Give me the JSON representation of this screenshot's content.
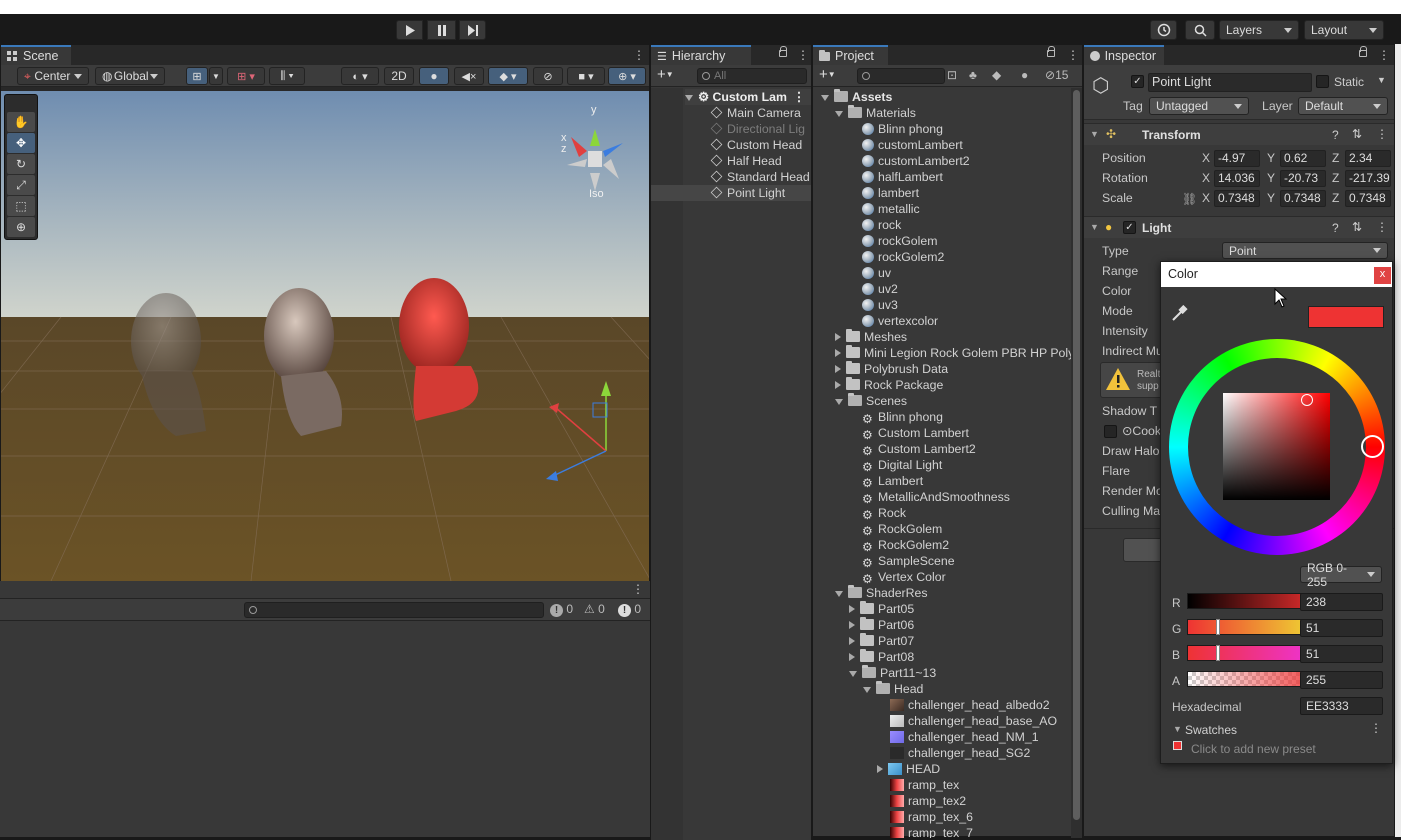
{
  "toolbar": {
    "play_icon": "play-icon",
    "pause_icon": "pause-icon",
    "step_icon": "step-icon",
    "history_icon": "history-icon",
    "search_icon": "search-icon",
    "layers": "Layers",
    "layout": "Layout"
  },
  "scene": {
    "tab": "Scene",
    "pivot": "Center",
    "space": "Global",
    "mode_2d": "2D",
    "gizmo_label": "Iso",
    "axis_y": "y",
    "axis_x": "x",
    "axis_z": "z",
    "tools": [
      "hand-tool-icon",
      "move-tool-icon",
      "rotate-tool-icon",
      "scale-tool-icon",
      "rect-tool-icon",
      "transform-tool-icon"
    ]
  },
  "console": {
    "info_count": "0",
    "warn_count": "0",
    "error_count": "0"
  },
  "hierarchy": {
    "tab": "Hierarchy",
    "search_placeholder": "All",
    "root": "Custom Lam",
    "items": [
      "Main Camera",
      "Directional Lig",
      "Custom Head",
      "Half Head",
      "Standard Head",
      "Point Light"
    ]
  },
  "project": {
    "tab": "Project",
    "hidden_count": "15",
    "rows": [
      {
        "label": "Assets",
        "indent": 0,
        "icon": "folder",
        "arrow": "down",
        "bold": true
      },
      {
        "label": "Materials",
        "indent": 1,
        "icon": "folder",
        "arrow": "down"
      },
      {
        "label": "Blinn phong",
        "indent": 2,
        "icon": "material"
      },
      {
        "label": "customLambert",
        "indent": 2,
        "icon": "material"
      },
      {
        "label": "customLambert2",
        "indent": 2,
        "icon": "material"
      },
      {
        "label": "halfLambert",
        "indent": 2,
        "icon": "material"
      },
      {
        "label": "lambert",
        "indent": 2,
        "icon": "material"
      },
      {
        "label": "metallic",
        "indent": 2,
        "icon": "material"
      },
      {
        "label": "rock",
        "indent": 2,
        "icon": "material"
      },
      {
        "label": "rockGolem",
        "indent": 2,
        "icon": "material"
      },
      {
        "label": "rockGolem2",
        "indent": 2,
        "icon": "material"
      },
      {
        "label": "uv",
        "indent": 2,
        "icon": "material"
      },
      {
        "label": "uv2",
        "indent": 2,
        "icon": "material"
      },
      {
        "label": "uv3",
        "indent": 2,
        "icon": "material"
      },
      {
        "label": "vertexcolor",
        "indent": 2,
        "icon": "material"
      },
      {
        "label": "Meshes",
        "indent": 1,
        "icon": "folder",
        "arrow": "right"
      },
      {
        "label": "Mini Legion Rock Golem PBR HP Poly",
        "indent": 1,
        "icon": "folder",
        "arrow": "right"
      },
      {
        "label": "Polybrush Data",
        "indent": 1,
        "icon": "folder",
        "arrow": "right"
      },
      {
        "label": "Rock Package",
        "indent": 1,
        "icon": "folder",
        "arrow": "right"
      },
      {
        "label": "Scenes",
        "indent": 1,
        "icon": "folder",
        "arrow": "down"
      },
      {
        "label": "Blinn phong",
        "indent": 2,
        "icon": "scene"
      },
      {
        "label": "Custom Lambert",
        "indent": 2,
        "icon": "scene"
      },
      {
        "label": "Custom Lambert2",
        "indent": 2,
        "icon": "scene"
      },
      {
        "label": "Digital Light",
        "indent": 2,
        "icon": "scene"
      },
      {
        "label": "Lambert",
        "indent": 2,
        "icon": "scene"
      },
      {
        "label": "MetallicAndSmoothness",
        "indent": 2,
        "icon": "scene"
      },
      {
        "label": "Rock",
        "indent": 2,
        "icon": "scene"
      },
      {
        "label": "RockGolem",
        "indent": 2,
        "icon": "scene"
      },
      {
        "label": "RockGolem2",
        "indent": 2,
        "icon": "scene"
      },
      {
        "label": "SampleScene",
        "indent": 2,
        "icon": "scene"
      },
      {
        "label": "Vertex Color",
        "indent": 2,
        "icon": "scene"
      },
      {
        "label": "ShaderRes",
        "indent": 1,
        "icon": "folder",
        "arrow": "down"
      },
      {
        "label": "Part05",
        "indent": 2,
        "icon": "folder",
        "arrow": "right"
      },
      {
        "label": "Part06",
        "indent": 2,
        "icon": "folder",
        "arrow": "right"
      },
      {
        "label": "Part07",
        "indent": 2,
        "icon": "folder",
        "arrow": "right"
      },
      {
        "label": "Part08",
        "indent": 2,
        "icon": "folder",
        "arrow": "right"
      },
      {
        "label": "Part11~13",
        "indent": 2,
        "icon": "folder",
        "arrow": "down"
      },
      {
        "label": "Head",
        "indent": 3,
        "icon": "folder",
        "arrow": "down"
      },
      {
        "label": "challenger_head_albedo2",
        "indent": 4,
        "icon": "tex-albedo"
      },
      {
        "label": "challenger_head_base_AO",
        "indent": 4,
        "icon": "tex-ao"
      },
      {
        "label": "challenger_head_NM_1",
        "indent": 4,
        "icon": "tex-normal"
      },
      {
        "label": "challenger_head_SG2",
        "indent": 4,
        "icon": "tex-sg"
      },
      {
        "label": "HEAD",
        "indent": 4,
        "icon": "prefab",
        "arrow": "right"
      },
      {
        "label": "ramp_tex",
        "indent": 4,
        "icon": "tex-ramp"
      },
      {
        "label": "ramp_tex2",
        "indent": 4,
        "icon": "tex-ramp"
      },
      {
        "label": "ramp_tex_6",
        "indent": 4,
        "icon": "tex-ramp"
      },
      {
        "label": "ramp_tex_7",
        "indent": 4,
        "icon": "tex-ramp"
      }
    ]
  },
  "inspector": {
    "tab": "Inspector",
    "object_name": "Point Light",
    "static_label": "Static",
    "tag_label": "Tag",
    "tag_value": "Untagged",
    "layer_label": "Layer",
    "layer_value": "Default",
    "transform": {
      "title": "Transform",
      "position_label": "Position",
      "rotation_label": "Rotation",
      "scale_label": "Scale",
      "position": [
        "-4.97",
        "0.62",
        "2.34"
      ],
      "rotation": [
        "14.036",
        "-20.73",
        "-217.39"
      ],
      "scale": [
        "0.7348",
        "0.7348",
        "0.7348"
      ]
    },
    "light": {
      "title": "Light",
      "type_label": "Type",
      "type_value": "Point",
      "labels": [
        "Range",
        "Color",
        "Mode",
        "Intensity",
        "Indirect Mu",
        "",
        "Shadow T",
        "",
        "Draw Halo",
        "Flare",
        "Render Mo",
        "Culling Ma"
      ],
      "warning_text": "Realt supp",
      "cookie_label": "Cook"
    }
  },
  "color_picker": {
    "title": "Color",
    "close": "x",
    "swatch_color": "#EE3333",
    "mode": "RGB 0-255",
    "channels": [
      {
        "label": "R",
        "value": "238",
        "fraction": 0.933
      },
      {
        "label": "G",
        "value": "51",
        "fraction": 0.2
      },
      {
        "label": "B",
        "value": "51",
        "fraction": 0.2
      },
      {
        "label": "A",
        "value": "255",
        "fraction": 1.0
      }
    ],
    "hex_label": "Hexadecimal",
    "hex_value": "EE3333",
    "swatches_label": "Swatches",
    "swatches_hint": "Click to add new preset"
  }
}
